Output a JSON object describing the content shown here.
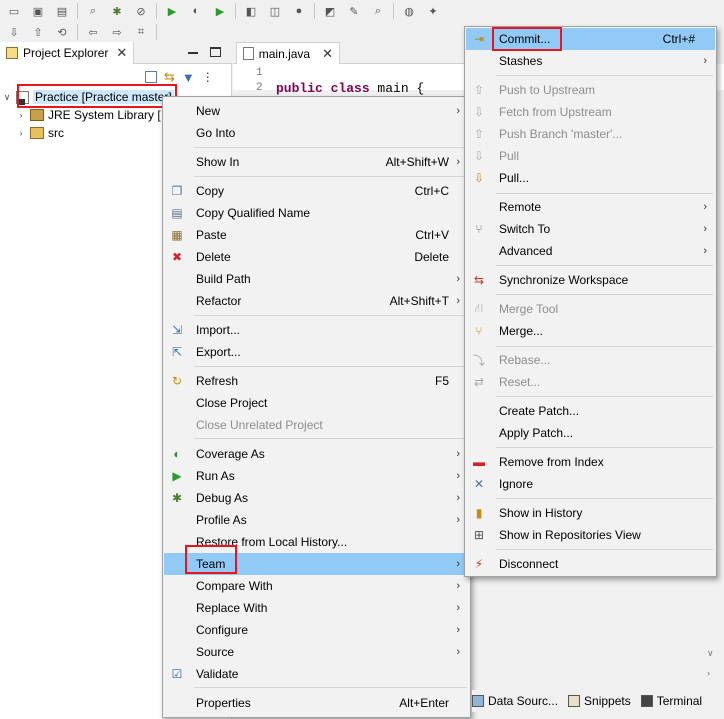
{
  "colors": {
    "menu_highlight": "#91c9f7",
    "annotation_red": "#e8141e",
    "keyword": "#7f0055"
  },
  "toolbar": {
    "row1_icons": [
      "new-icon",
      "save-icon",
      "save-all-icon",
      "search-icon",
      "debug-icon",
      "skip-breakpoints-icon",
      "run-icon",
      "coverage-icon",
      "external-tools-icon",
      "new-java-project-icon",
      "new-package-icon",
      "new-class-icon",
      "open-type-icon",
      "open-task-icon",
      "search-icon",
      "web-browser-icon",
      "perspective-icon"
    ],
    "row2_icons": [
      "next-annotation-icon",
      "previous-annotation-icon",
      "last-edit-icon",
      "back-icon",
      "forward-icon",
      "pin-editor-icon"
    ]
  },
  "project_explorer": {
    "tab_label": "Project Explorer",
    "tree": [
      {
        "label": "Practice [Practice master]",
        "expanded": true,
        "icon": "java-project-icon"
      },
      {
        "label": "JRE System Library [",
        "icon": "library-icon"
      },
      {
        "label": "src",
        "icon": "source-folder-icon"
      }
    ]
  },
  "editor": {
    "tab_label": "main.java",
    "lines": [
      {
        "num": "1",
        "code": ""
      },
      {
        "num": "2",
        "keyword": "public class",
        "rest": " main {"
      }
    ]
  },
  "context_menu": {
    "items": [
      {
        "label": "New",
        "shortcut": "",
        "arrow": true,
        "icon": ""
      },
      {
        "label": "Go Into",
        "shortcut": "",
        "arrow": false,
        "icon": ""
      },
      {
        "label": "Show In",
        "shortcut": "Alt+Shift+W",
        "arrow": true,
        "icon": ""
      },
      {
        "label": "Copy",
        "shortcut": "Ctrl+C",
        "arrow": false,
        "icon": "copy-icon"
      },
      {
        "label": "Copy Qualified Name",
        "shortcut": "",
        "arrow": false,
        "icon": "copy-qualified-icon"
      },
      {
        "label": "Paste",
        "shortcut": "Ctrl+V",
        "arrow": false,
        "icon": "paste-icon"
      },
      {
        "label": "Delete",
        "shortcut": "Delete",
        "arrow": false,
        "icon": "delete-icon"
      },
      {
        "label": "Build Path",
        "shortcut": "",
        "arrow": true,
        "icon": ""
      },
      {
        "label": "Refactor",
        "shortcut": "Alt+Shift+T",
        "arrow": true,
        "icon": ""
      },
      {
        "label": "Import...",
        "shortcut": "",
        "arrow": false,
        "icon": "import-icon"
      },
      {
        "label": "Export...",
        "shortcut": "",
        "arrow": false,
        "icon": "export-icon"
      },
      {
        "label": "Refresh",
        "shortcut": "F5",
        "arrow": false,
        "icon": "refresh-icon"
      },
      {
        "label": "Close Project",
        "shortcut": "",
        "arrow": false,
        "icon": ""
      },
      {
        "label": "Close Unrelated Project",
        "shortcut": "",
        "arrow": false,
        "icon": "",
        "disabled": true
      },
      {
        "label": "Coverage As",
        "shortcut": "",
        "arrow": true,
        "icon": "coverage-icon"
      },
      {
        "label": "Run As",
        "shortcut": "",
        "arrow": true,
        "icon": "run-icon"
      },
      {
        "label": "Debug As",
        "shortcut": "",
        "arrow": true,
        "icon": "debug-icon"
      },
      {
        "label": "Profile As",
        "shortcut": "",
        "arrow": true,
        "icon": ""
      },
      {
        "label": "Restore from Local History...",
        "shortcut": "",
        "arrow": false,
        "icon": ""
      },
      {
        "label": "Team",
        "shortcut": "",
        "arrow": true,
        "icon": "",
        "highlighted": true
      },
      {
        "label": "Compare With",
        "shortcut": "",
        "arrow": true,
        "icon": ""
      },
      {
        "label": "Replace With",
        "shortcut": "",
        "arrow": true,
        "icon": ""
      },
      {
        "label": "Configure",
        "shortcut": "",
        "arrow": true,
        "icon": ""
      },
      {
        "label": "Source",
        "shortcut": "",
        "arrow": true,
        "icon": ""
      },
      {
        "label": "Validate",
        "shortcut": "",
        "arrow": false,
        "icon": "checkmark-icon"
      },
      {
        "label": "Properties",
        "shortcut": "Alt+Enter",
        "arrow": false,
        "icon": ""
      }
    ]
  },
  "team_menu": {
    "items": [
      {
        "label": "Commit...",
        "shortcut": "Ctrl+#",
        "arrow": false,
        "icon": "commit-icon",
        "highlighted": true
      },
      {
        "label": "Stashes",
        "shortcut": "",
        "arrow": true,
        "icon": ""
      },
      {
        "label": "Push to Upstream",
        "shortcut": "",
        "arrow": false,
        "icon": "push-icon",
        "disabled": true
      },
      {
        "label": "Fetch from Upstream",
        "shortcut": "",
        "arrow": false,
        "icon": "fetch-icon",
        "disabled": true
      },
      {
        "label": "Push Branch 'master'...",
        "shortcut": "",
        "arrow": false,
        "icon": "push-branch-icon",
        "disabled": true
      },
      {
        "label": "Pull",
        "shortcut": "",
        "arrow": false,
        "icon": "pull-icon",
        "disabled": true
      },
      {
        "label": "Pull...",
        "shortcut": "",
        "arrow": false,
        "icon": "pull-dialog-icon"
      },
      {
        "label": "Remote",
        "shortcut": "",
        "arrow": true,
        "icon": ""
      },
      {
        "label": "Switch To",
        "shortcut": "",
        "arrow": true,
        "icon": "switch-branch-icon"
      },
      {
        "label": "Advanced",
        "shortcut": "",
        "arrow": true,
        "icon": ""
      },
      {
        "label": "Synchronize Workspace",
        "shortcut": "",
        "arrow": false,
        "icon": "synchronize-icon"
      },
      {
        "label": "Merge Tool",
        "shortcut": "",
        "arrow": false,
        "icon": "merge-tool-icon",
        "disabled": true
      },
      {
        "label": "Merge...",
        "shortcut": "",
        "arrow": false,
        "icon": "merge-icon"
      },
      {
        "label": "Rebase...",
        "shortcut": "",
        "arrow": false,
        "icon": "rebase-icon",
        "disabled": true
      },
      {
        "label": "Reset...",
        "shortcut": "",
        "arrow": false,
        "icon": "reset-icon",
        "disabled": true
      },
      {
        "label": "Create Patch...",
        "shortcut": "",
        "arrow": false,
        "icon": ""
      },
      {
        "label": "Apply Patch...",
        "shortcut": "",
        "arrow": false,
        "icon": ""
      },
      {
        "label": "Remove from Index",
        "shortcut": "",
        "arrow": false,
        "icon": "remove-icon"
      },
      {
        "label": "Ignore",
        "shortcut": "",
        "arrow": false,
        "icon": "ignore-icon"
      },
      {
        "label": "Show in History",
        "shortcut": "",
        "arrow": false,
        "icon": "history-icon"
      },
      {
        "label": "Show in Repositories View",
        "shortcut": "",
        "arrow": false,
        "icon": "git-repository-icon"
      },
      {
        "label": "Disconnect",
        "shortcut": "",
        "arrow": false,
        "icon": "disconnect-icon"
      }
    ]
  },
  "bottom_tabs": [
    {
      "label": "Data Sourc...",
      "icon": "data-source-icon"
    },
    {
      "label": "Snippets",
      "icon": "snippets-icon"
    },
    {
      "label": "Terminal",
      "icon": "terminal-icon"
    }
  ]
}
